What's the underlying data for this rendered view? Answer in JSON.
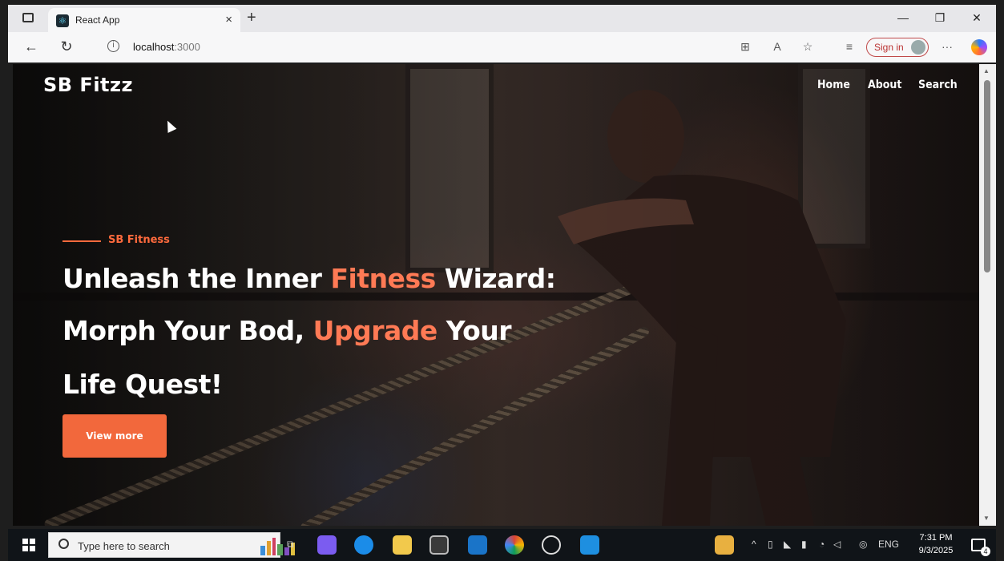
{
  "browser": {
    "tab_title": "React App",
    "url_host": "localhost",
    "url_port": ":3000",
    "sign_in_label": "Sign in",
    "more_label": "···"
  },
  "site": {
    "brand": "SB Fitzz",
    "nav": [
      "Home",
      "About",
      "Search"
    ],
    "kicker": "SB Fitness",
    "headline": {
      "line1_pre": "Unleash the Inner ",
      "line1_accent": "Fitness",
      "line1_post": " Wizard:",
      "line2_pre": "Morph Your Bod, ",
      "line2_accent": "Upgrade",
      "line2_post": " Your",
      "line3": "Life Quest!"
    },
    "cta_label": "View more"
  },
  "taskbar": {
    "search_placeholder": "Type here to search",
    "language": "ENG",
    "time": "7:31 PM",
    "date": "9/3/2025",
    "notification_count": "4"
  },
  "colors": {
    "accent": "#ff6a3d",
    "cta_bg": "#f2683c"
  }
}
